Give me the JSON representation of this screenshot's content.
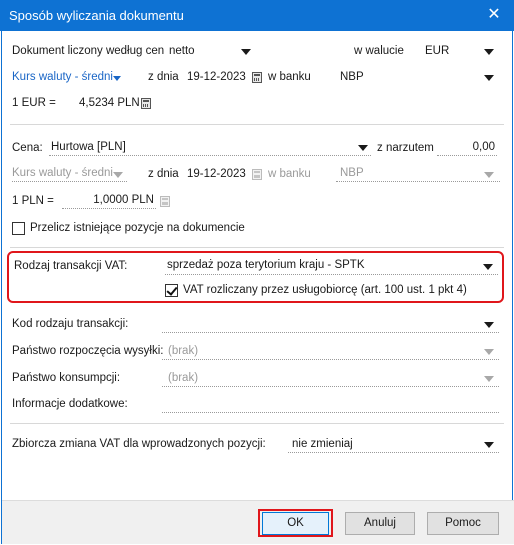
{
  "window": {
    "title": "Sposób wyliczania dokumentu",
    "close_glyph": "✕"
  },
  "doc": {
    "label": "Dokument liczony według cen",
    "price_type": "netto",
    "currency_label": "w walucie",
    "currency": "EUR",
    "rate_type": "Kurs waluty - średni",
    "date_label": "z dnia",
    "date": "19-12-2023",
    "bank_label": "w banku",
    "bank": "NBP",
    "rate_unit": "1 EUR =",
    "rate_value": "4,5234 PLN"
  },
  "price": {
    "label": "Cena:",
    "value": "Hurtowa [PLN]",
    "markup_label": "z narzutem",
    "markup_value": "0,00",
    "rate_type": "Kurs waluty - średni",
    "date_label": "z dnia",
    "date": "19-12-2023",
    "bank_label": "w banku",
    "bank": "NBP",
    "rate_unit": "1 PLN =",
    "rate_value": "1,0000 PLN",
    "recalc_label": "Przelicz istniejące pozycje na dokumencie",
    "recalc_checked": false
  },
  "vat": {
    "label": "Rodzaj transakcji VAT:",
    "value": "sprzedaż poza terytorium kraju - SPTK",
    "service_label": "VAT rozliczany przez usługobiorcę (art. 100 ust. 1 pkt 4)",
    "service_checked": true
  },
  "transaction": {
    "code_label": "Kod rodzaju transakcji:",
    "code_value": "",
    "dispatch_label": "Państwo rozpoczęcia wysyłki:",
    "dispatch_value": "(brak)",
    "consumption_label": "Państwo konsumpcji:",
    "consumption_value": "(brak)",
    "info_label": "Informacje dodatkowe:",
    "info_value": ""
  },
  "bulk": {
    "label": "Zbiorcza zmiana VAT dla wprowadzonych pozycji:",
    "value": "nie zmieniaj"
  },
  "buttons": {
    "ok": "OK",
    "cancel": "Anuluj",
    "help": "Pomoc"
  },
  "colors": {
    "title_bar": "#0e72d3",
    "highlight": "#e0161b",
    "link": "#1a66c6"
  }
}
